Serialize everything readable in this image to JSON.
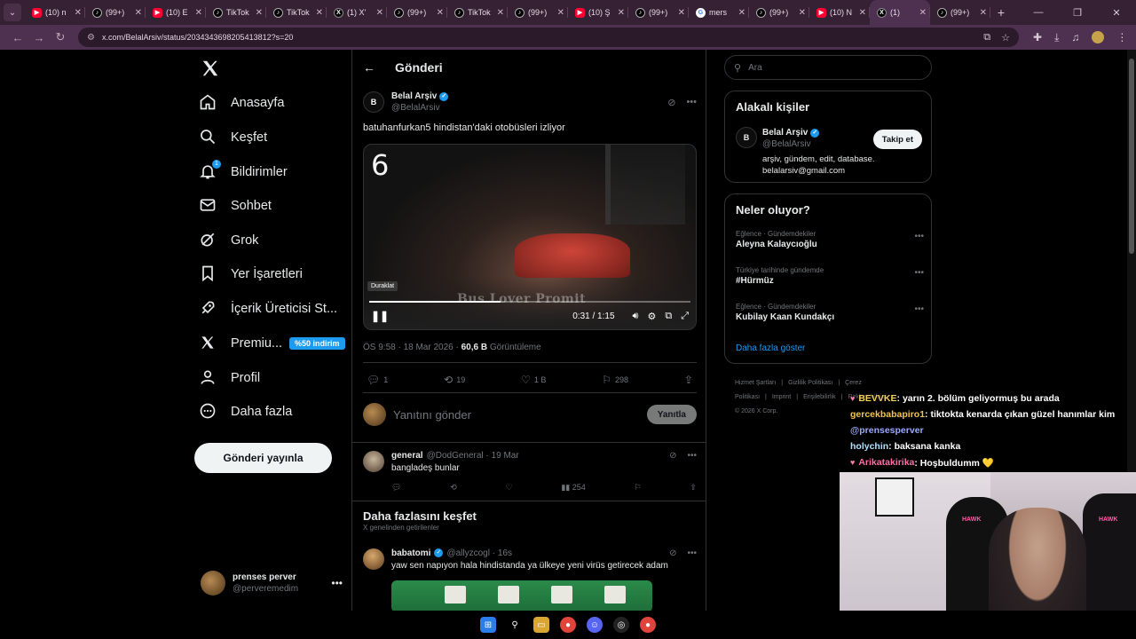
{
  "browser": {
    "tabs": [
      {
        "title": "(10) n",
        "icon": "youtube-icon",
        "active": false
      },
      {
        "title": "(99+)",
        "icon": "tiktok-icon",
        "active": false
      },
      {
        "title": "(10) E",
        "icon": "youtube-icon",
        "active": false
      },
      {
        "title": "TikTok",
        "icon": "tiktok-icon",
        "active": false
      },
      {
        "title": "TikTok",
        "icon": "tiktok-icon",
        "active": false
      },
      {
        "title": "(1) X'",
        "icon": "x-icon",
        "active": false
      },
      {
        "title": "(99+)",
        "icon": "tiktok-icon",
        "active": false
      },
      {
        "title": "TikTok",
        "icon": "tiktok-icon",
        "active": false
      },
      {
        "title": "(99+)",
        "icon": "tiktok-icon",
        "active": false
      },
      {
        "title": "(10) Ş",
        "icon": "youtube-icon",
        "active": false
      },
      {
        "title": "(99+)",
        "icon": "tiktok-icon",
        "active": false
      },
      {
        "title": "mers",
        "icon": "google-icon",
        "active": false
      },
      {
        "title": "(99+)",
        "icon": "tiktok-icon",
        "active": false
      },
      {
        "title": "(10) N",
        "icon": "youtube-icon",
        "active": false
      },
      {
        "title": "(1)",
        "icon": "x-icon",
        "active": true
      },
      {
        "title": "(99+)",
        "icon": "tiktok-icon",
        "active": false
      }
    ],
    "url": "x.com/BelalArsiv/status/2034343698205413812?s=20"
  },
  "leftnav": {
    "items": [
      {
        "label": "Anasayfa",
        "icon": "home-icon"
      },
      {
        "label": "Keşfet",
        "icon": "search-icon"
      },
      {
        "label": "Bildirimler",
        "icon": "bell-icon",
        "badge": "1"
      },
      {
        "label": "Sohbet",
        "icon": "mail-icon"
      },
      {
        "label": "Grok",
        "icon": "grok-icon"
      },
      {
        "label": "Yer İşaretleri",
        "icon": "bookmark-icon"
      },
      {
        "label": "İçerik Üreticisi St...",
        "icon": "rocket-icon"
      },
      {
        "label": "Premiu...",
        "icon": "x-premium-icon",
        "promo": "%50 indirim"
      },
      {
        "label": "Profil",
        "icon": "person-icon"
      },
      {
        "label": "Daha fazla",
        "icon": "more-circle-icon"
      }
    ],
    "post_button": "Gönderi yayınla",
    "me": {
      "name": "prenses perver",
      "handle": "@perveremedim"
    }
  },
  "center": {
    "header_title": "Gönderi",
    "post": {
      "author": "Belal Arşiv",
      "handle": "@BelalArsiv",
      "avatar_text": "B",
      "text": "batuhanfurkan5 hindistan'daki otobüsleri izliyor",
      "video": {
        "overlay_number": "6",
        "watermark": "Bus Lover Promit",
        "tooltip": "Duraklat",
        "time": "0:31 / 1:15",
        "progress": 0.41
      },
      "meta_time": "ÖS 9:58 · 18 Mar 2026 · ",
      "views_value": "60,6 B",
      "views_label": " Görüntüleme",
      "stats": {
        "replies": "1",
        "reposts": "19",
        "likes": "1 B",
        "bookmarks": "298"
      }
    },
    "reply_placeholder": "Yanıtını gönder",
    "reply_button": "Yanıtla",
    "reply": {
      "author": "general",
      "handle": "@DodGeneral · 19 Mar",
      "text": "bangladeş bunlar",
      "views": "254"
    },
    "explore": {
      "title": "Daha fazlasını keşfet",
      "subtitle": "X genelinden getirilenler"
    },
    "recommended": {
      "author": "babatomi",
      "handle": "@allyzcogl · 16s",
      "text": "yaw sen napıyon hala hindistanda ya ülkeye yeni virüs getirecek adam"
    }
  },
  "right": {
    "search_placeholder": "Ara",
    "related": {
      "title": "Alakalı kişiler",
      "name": "Belal Arşiv",
      "handle": "@BelalArsiv",
      "follow": "Takip et",
      "bio": "arşiv, gündem, edit, database. belalarsiv@gmail.com"
    },
    "trends": {
      "title": "Neler oluyor?",
      "items": [
        {
          "category": "Eğlence · Gündemdekiler",
          "name": "Aleyna Kalaycıoğlu"
        },
        {
          "category": "Türkiye tarihinde gündemde",
          "name": "#Hürmüz"
        },
        {
          "category": "Eğlence · Gündemdekiler",
          "name": "Kubilay Kaan Kundakçı"
        }
      ],
      "show_more": "Daha fazla göster"
    },
    "footer": {
      "links": [
        "Hizmet Şartları",
        "|",
        "Gizlilik Politikası",
        "|",
        "Çerez Politikası",
        "|",
        "Imprint",
        "|",
        "Erişilebilirlik",
        "|",
        "Reklam bilgisi"
      ],
      "copyright": "© 2026 X Corp."
    }
  },
  "chat": [
    {
      "user": "BEVVKE",
      "color": "#f3d25a",
      "message": ": yarın 2. bölüm geliyormuş bu arada",
      "heart": true
    },
    {
      "user": "gercekbabapiro1",
      "color": "#f1c44f",
      "message": ": tiktokta kenarda çıkan güzel hanımlar kim",
      "heart": false
    },
    {
      "user": "@prensesperver",
      "color": "#9aa7ff",
      "message": "",
      "heart": false
    },
    {
      "user": "holychin",
      "color": "#aee3ff",
      "message": ": baksana kanka",
      "heart": false
    },
    {
      "user": "Arikatakirika",
      "color": "#ff6fa8",
      "message": ": Hoşbuldumm 💛",
      "heart": true
    }
  ],
  "webcam": {
    "chair_brand": "HAWK"
  },
  "colors": {
    "accent": "#1d9bf0",
    "tabbar": "#352034",
    "background": "#000000"
  }
}
